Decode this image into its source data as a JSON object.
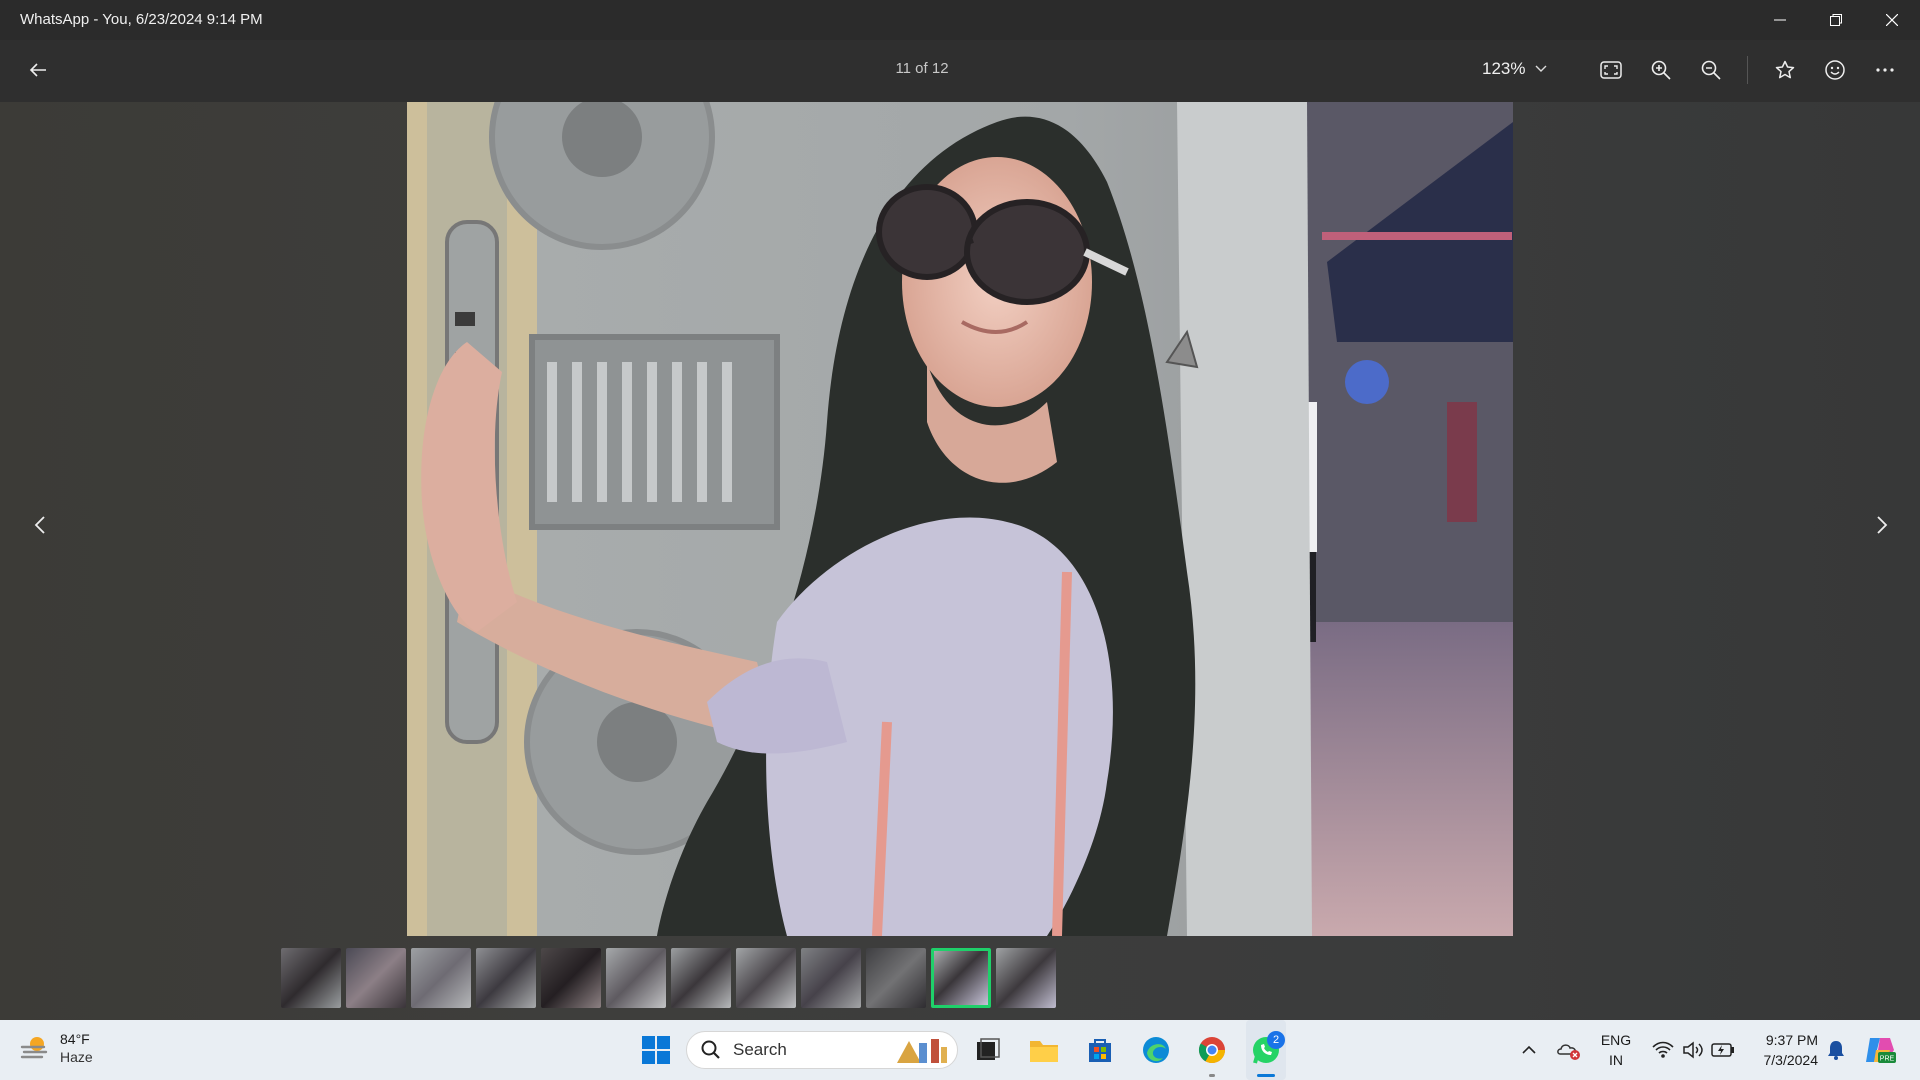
{
  "window": {
    "title": "WhatsApp - You, 6/23/2024 9:14 PM",
    "controls": [
      "minimize",
      "restore",
      "close"
    ]
  },
  "toolbar": {
    "back_icon": "arrow-left-icon",
    "counter": "11 of 12",
    "zoom_level": "123%",
    "icons": [
      "fit-to-window-icon",
      "zoom-in-icon",
      "zoom-out-icon",
      "star-icon",
      "emoji-icon",
      "more-icon"
    ]
  },
  "viewer": {
    "photo_description": "Woman wearing sunglasses in a lavender top, leaning against a grey themed wall",
    "prev_icon": "chevron-left-icon",
    "next_icon": "chevron-right-icon"
  },
  "filmstrip": {
    "count": 12,
    "active_index": 10
  },
  "taskbar": {
    "weather": {
      "temp": "84°F",
      "condition": "Haze"
    },
    "search_placeholder": "Search",
    "apps": [
      "windows-start",
      "search",
      "task-view",
      "file-explorer",
      "microsoft-store",
      "edge",
      "chrome",
      "whatsapp"
    ],
    "whatsapp_badge": "2",
    "language": {
      "line1": "ENG",
      "line2": "IN"
    },
    "clock": {
      "time": "9:37 PM",
      "date": "7/3/2024"
    },
    "accent": "#1fd06a",
    "badge_color": "#1a73e8"
  }
}
